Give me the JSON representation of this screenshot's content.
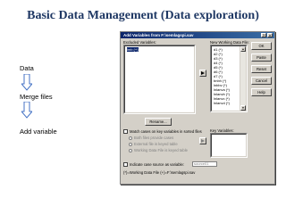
{
  "slide": {
    "title": "Basic Data Management (Data exploration)",
    "steps": [
      "Data",
      "Merge files",
      "Add variable"
    ]
  },
  "dialog": {
    "title": "Add Variables from F:\\semlagspi.sav",
    "excluded_label": "Excluded Variables:",
    "excluded_items": [
      "lmb (+)"
    ],
    "new_label": "New Working Data File:",
    "new_items": [
      "d1 (*)",
      "d2 (*)",
      "d3 (*)",
      "d4 (*)",
      "d5 (*)",
      "d6 (*)",
      "d7 (*)",
      "bnbh (*)",
      "lnbbv (*)",
      "lnlanva (*)",
      "lnlanvb (*)",
      "lnlanvc (*)",
      "lnlanvd (*)"
    ],
    "buttons": {
      "ok": "OK",
      "paste": "Paste",
      "reset": "Reset",
      "cancel": "Cancel",
      "help": "Help"
    },
    "rename": "Rename...",
    "match_label": "Match cases on key variables in sorted files",
    "radio_options": [
      "Both files provide cases",
      "External file is keyed table",
      "Working Data File is keyed table"
    ],
    "key_label": "Key Variables:",
    "indicate_label": "Indicate case source as variable:",
    "indicate_value": "source01",
    "footer": "(*)=Working Data File    (+)=F:\\semlagspi.sav"
  }
}
